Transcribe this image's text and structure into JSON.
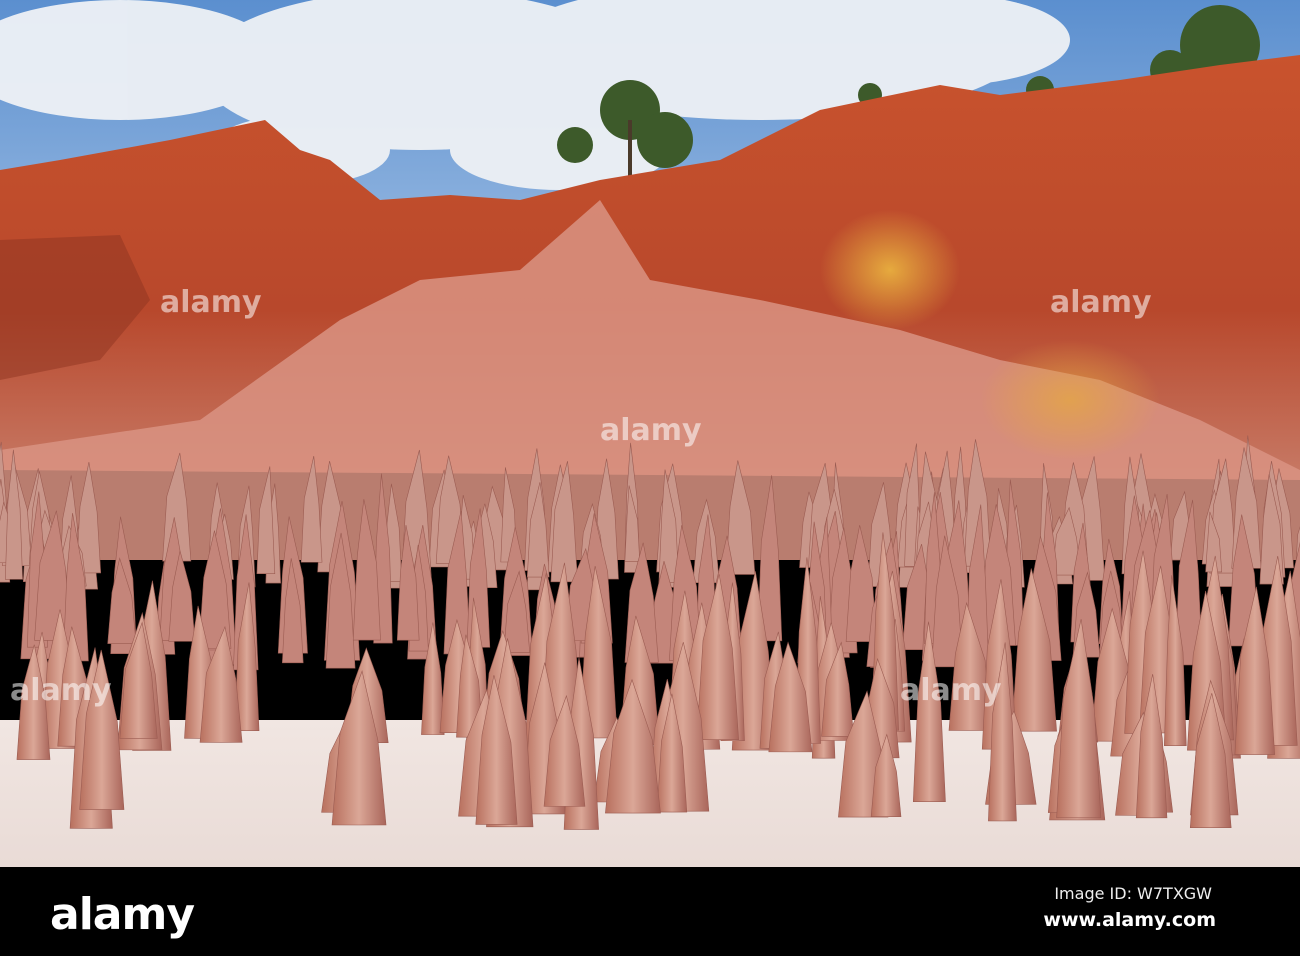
{
  "photo": {
    "watermark": "alamy"
  },
  "footer": {
    "logo": "alamy",
    "image_id": "Image ID: W7TXGW",
    "url": "www.alamy.com"
  },
  "colors": {
    "sky": "#6fa0d8",
    "cloud": "#eef1f5",
    "cliff": "#c8552f",
    "cliff_dark": "#9c3a22",
    "ochre": "#d89a3c",
    "spire": "#c98f7c",
    "spire_light": "#e8c4b8",
    "sand": "#efe3de"
  }
}
